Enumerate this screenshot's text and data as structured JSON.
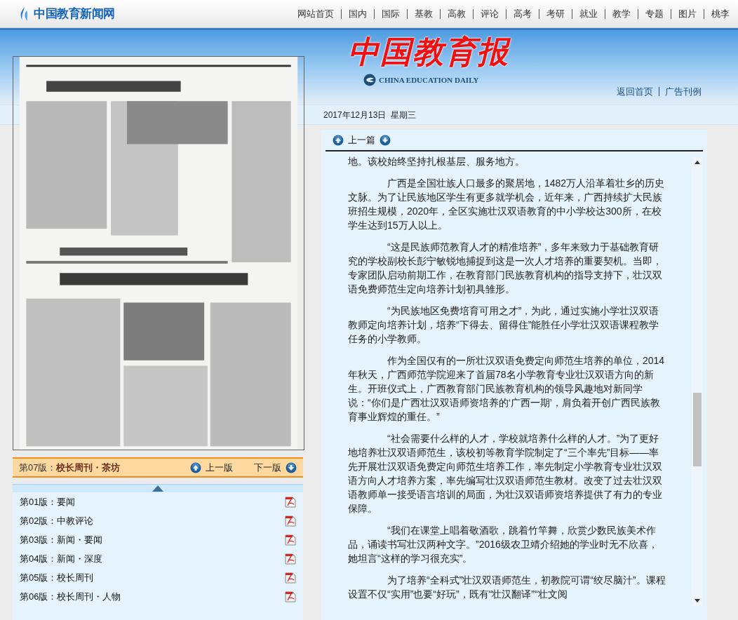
{
  "site": {
    "name": "中国教育新闻网"
  },
  "nav": [
    {
      "label": "网站首页"
    },
    {
      "label": "国内"
    },
    {
      "label": "国际"
    },
    {
      "label": "基教"
    },
    {
      "label": "高教"
    },
    {
      "label": "评论"
    },
    {
      "label": "高考"
    },
    {
      "label": "考研"
    },
    {
      "label": "就业"
    },
    {
      "label": "教学"
    },
    {
      "label": "专题"
    },
    {
      "label": "图片"
    },
    {
      "label": "桃李"
    }
  ],
  "masthead": {
    "title": "中国教育报",
    "subtitle": "CHINA EDUCATION DAILY",
    "links": [
      "返回首页",
      "广告刊例"
    ]
  },
  "date": "2017年12月13日  星期三",
  "edition_bar": {
    "number": "第07版：",
    "name": "校长周刊・茶坊",
    "prev": "上一版",
    "next": "下一版"
  },
  "editions": [
    {
      "number": "第01版：",
      "name": "要闻"
    },
    {
      "number": "第02版：",
      "name": "中教评论"
    },
    {
      "number": "第03版：",
      "name": "新闻・要闻"
    },
    {
      "number": "第04版：",
      "name": "新闻・深度"
    },
    {
      "number": "第05版：",
      "name": "校长周刊"
    },
    {
      "number": "第06版：",
      "name": "校长周刊・人物"
    }
  ],
  "article": {
    "prev": "上一篇",
    "paragraphs": [
      {
        "text": "地。该校始终坚持扎根基层、服务地方。",
        "indent": false
      },
      {
        "text": "广西是全国壮族人口最多的聚居地，1482万人沿革着壮乡的历史文脉。为了让民族地区学生有更多就学机会，近年来，广西持续扩大民族班招生规模，2020年，全区实施壮汉双语教育的中小学校达300所，在校学生达到15万人以上。",
        "indent": true
      },
      {
        "text": "“这是民族师范教育人才的精准培养”，多年来致力于基础教育研究的学校副校长彭宁敏锐地捕捉到这是一次人才培养的重要契机。当即，专家团队启动前期工作，在教育部门民族教育机构的指导支持下，壮汉双语免费师范生定向培养计划初具雏形。",
        "indent": true
      },
      {
        "text": "“为民族地区免费培育可用之才”，为此，通过实施小学壮汉双语教师定向培养计划，培养“下得去、留得住”能胜任小学壮汉双语课程教学任务的小学教师。",
        "indent": true
      },
      {
        "text": "作为全国仅有的一所壮汉双语免费定向师范生培养的单位，2014年秋天，广西师范学院迎来了首届78名小学教育专业壮汉双语方向的新生。开班仪式上，广西教育部门民族教育机构的领导风趣地对新同学说：“你们是广西壮汉双语师资培养的‘广西一期’，肩负着开创广西民族教育事业辉煌的重任。”",
        "indent": true
      },
      {
        "text": "“社会需要什么样的人才，学校就培养什么样的人才。”为了更好地培养壮汉双语师范生，该校初等教育学院制定了“三个率先”目标——率先开展壮汉双语免费定向师范生培养工作，率先制定小学教育专业壮汉双语方向人才培养方案，率先编写壮汉双语师范生教材。改变了过去壮汉双语教师单一接受语言培训的局面，为壮汉双语师资培养提供了有力的专业保障。",
        "indent": true
      },
      {
        "text": "“我们在课堂上唱着敬酒歌，跳着竹竿舞，欣赏少数民族美术作品，诵读书写壮汉两种文字。”2016级农卫靖介绍她的学业时无不欣喜，她坦言“这样的学习很充实”。",
        "indent": true
      },
      {
        "text": "为了培养“全科式”壮汉双语师范生，初教院可谓“绞尽脑汁”。课程设置不仅“实用”也要“好玩”，既有“壮汉翻译”“壮文阅",
        "indent": true
      }
    ]
  }
}
